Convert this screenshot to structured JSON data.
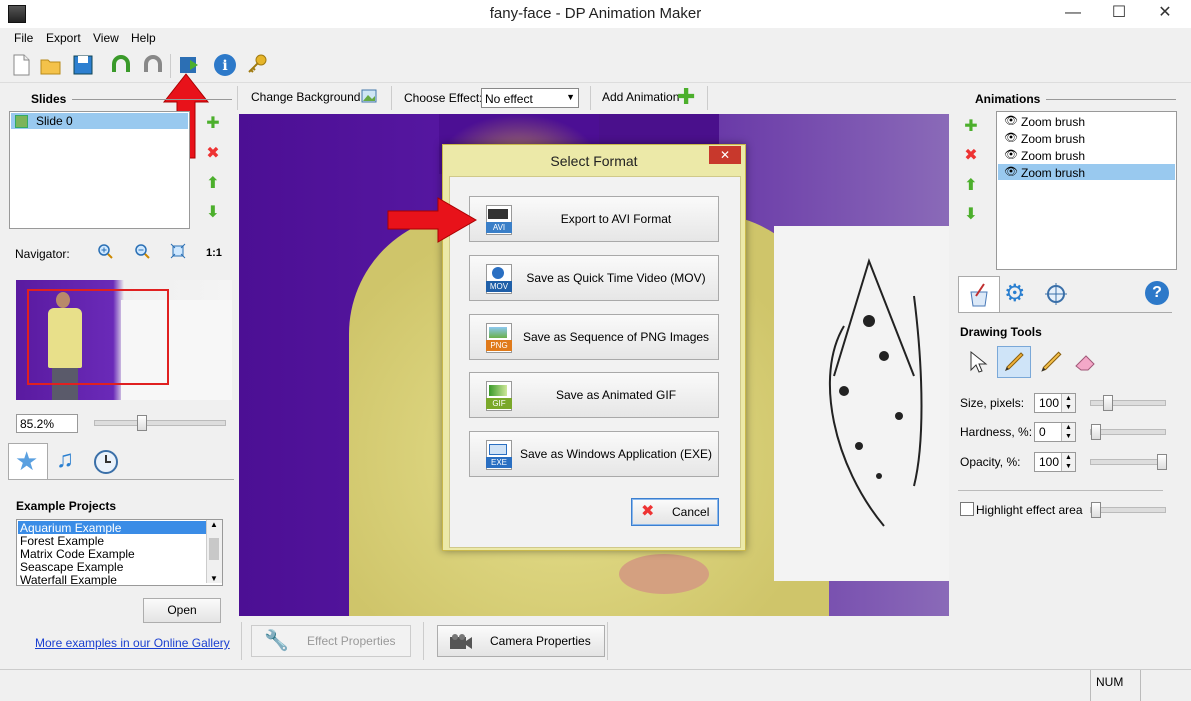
{
  "window": {
    "title": "fany-face - DP Animation Maker",
    "minimize": "—",
    "maximize": "☐",
    "close": "✕"
  },
  "menu": {
    "file": "File",
    "export": "Export",
    "view": "View",
    "help": "Help"
  },
  "toolbar": {
    "icons": [
      "new-file-icon",
      "open-folder-icon",
      "save-icon",
      "undo-icon",
      "redo-icon",
      "export-icon",
      "info-icon",
      "key-icon"
    ],
    "change_background": "Change Background",
    "choose_effect": "Choose Effect:",
    "effect_value": "No effect",
    "add_animation": "Add Animation"
  },
  "slides": {
    "title": "Slides",
    "items": [
      "Slide 0"
    ]
  },
  "navigator": {
    "label": "Navigator:",
    "ratio": "1:1",
    "zoom": "85.2%"
  },
  "examples": {
    "title": "Example Projects",
    "items": [
      "Aquarium Example",
      "Forest Example",
      "Matrix Code Example",
      "Seascape Example",
      "Waterfall Example"
    ],
    "open": "Open",
    "gallery_link": "More examples in our Online Gallery"
  },
  "bottom": {
    "effect_properties": "Effect Properties",
    "camera_properties": "Camera Properties"
  },
  "animations": {
    "title": "Animations",
    "items": [
      "Zoom brush",
      "Zoom brush",
      "Zoom brush",
      "Zoom brush"
    ],
    "selected_index": 3
  },
  "drawing": {
    "title": "Drawing Tools",
    "size_label": "Size, pixels:",
    "size_value": "100",
    "hardness_label": "Hardness, %:",
    "hardness_value": "0",
    "opacity_label": "Opacity, %:",
    "opacity_value": "100",
    "highlight": "Highlight effect area",
    "help": "?"
  },
  "dialog": {
    "title": "Select Format",
    "close": "✕",
    "options": [
      {
        "label": "Export to AVI Format",
        "badge": "AVI",
        "color": "#3a7fc8"
      },
      {
        "label": "Save as Quick Time Video (MOV)",
        "badge": "MOV",
        "color": "#1f5fa8"
      },
      {
        "label": "Save as Sequence of PNG Images",
        "badge": "PNG",
        "color": "#e07a1a"
      },
      {
        "label": "Save as Animated GIF",
        "badge": "GIF",
        "color": "#7aa82a"
      },
      {
        "label": "Save as Windows Application (EXE)",
        "badge": "EXE",
        "color": "#2a6fc2"
      }
    ],
    "cancel": "Cancel"
  },
  "status": {
    "num": "NUM"
  },
  "colors": {
    "accent": "#99c9ef",
    "dialog_bg": "#ece9a8",
    "dialog_border": "#c9b84a",
    "close_red": "#c8382c",
    "arrow_red": "#e8121a"
  }
}
